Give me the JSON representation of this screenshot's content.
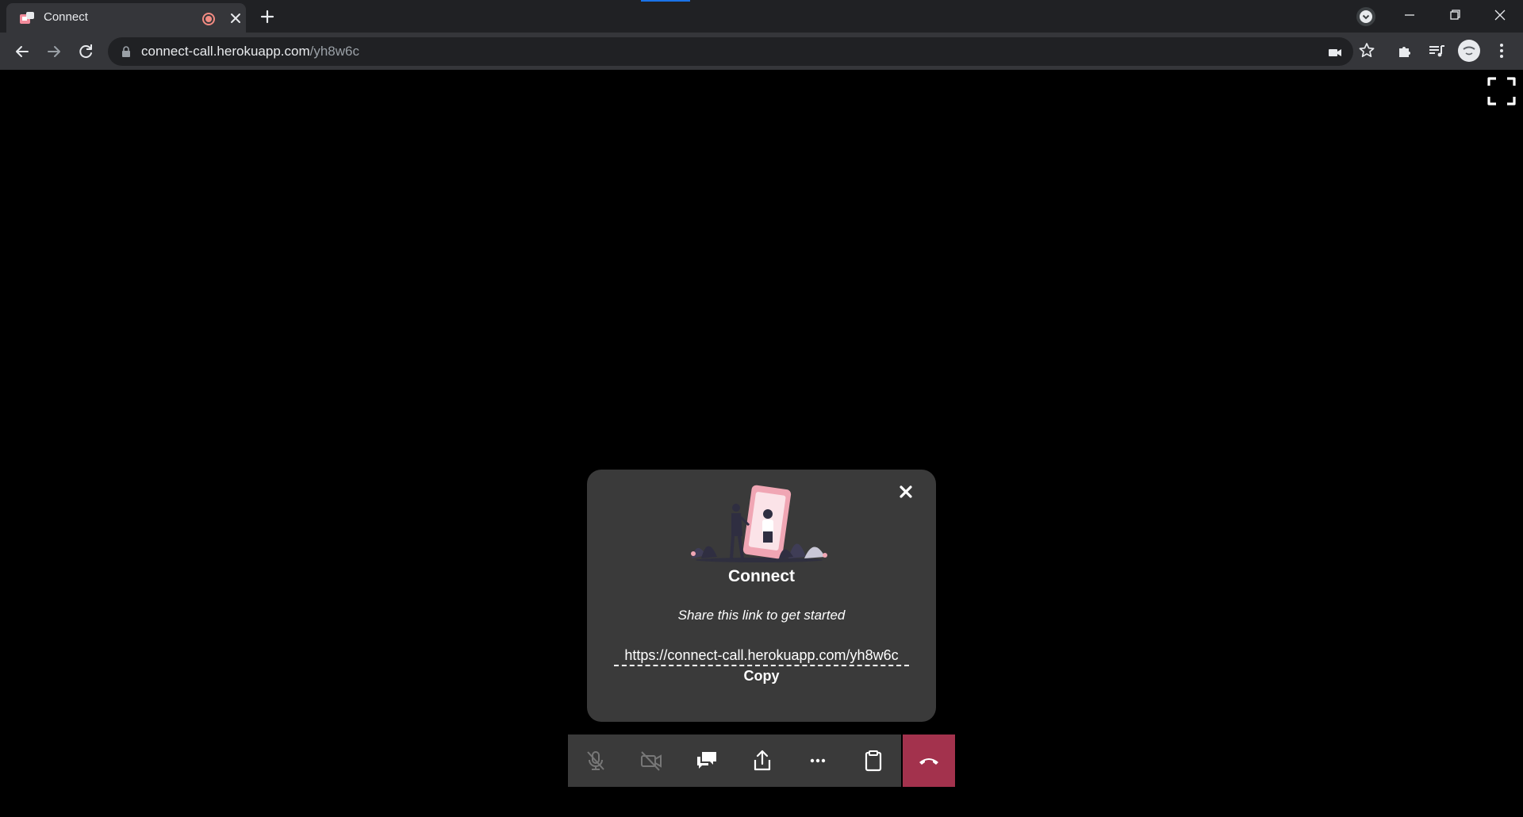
{
  "browser": {
    "tab": {
      "title": "Connect"
    },
    "address": {
      "host": "connect-call.herokuapp.com",
      "path": "/yh8w6c"
    }
  },
  "modal": {
    "title": "Connect",
    "subtitle": "Share this link to get started",
    "link": "https://connect-call.herokuapp.com/yh8w6c",
    "copy_label": "Copy"
  },
  "controls": {
    "items": [
      {
        "icon": "mic-off-icon",
        "state": "disabled"
      },
      {
        "icon": "video-off-icon",
        "state": "disabled"
      },
      {
        "icon": "chat-icon",
        "state": "enabled"
      },
      {
        "icon": "share-screen-icon",
        "state": "enabled"
      },
      {
        "icon": "more-icon",
        "state": "enabled"
      },
      {
        "icon": "clipboard-icon",
        "state": "enabled"
      },
      {
        "icon": "end-call-icon",
        "state": "enabled"
      }
    ]
  },
  "colors": {
    "end_call": "#a3324d",
    "modal_bg": "#3a3a3a",
    "recording": "#f28b82",
    "accent_pink": "#f0a6b4"
  }
}
